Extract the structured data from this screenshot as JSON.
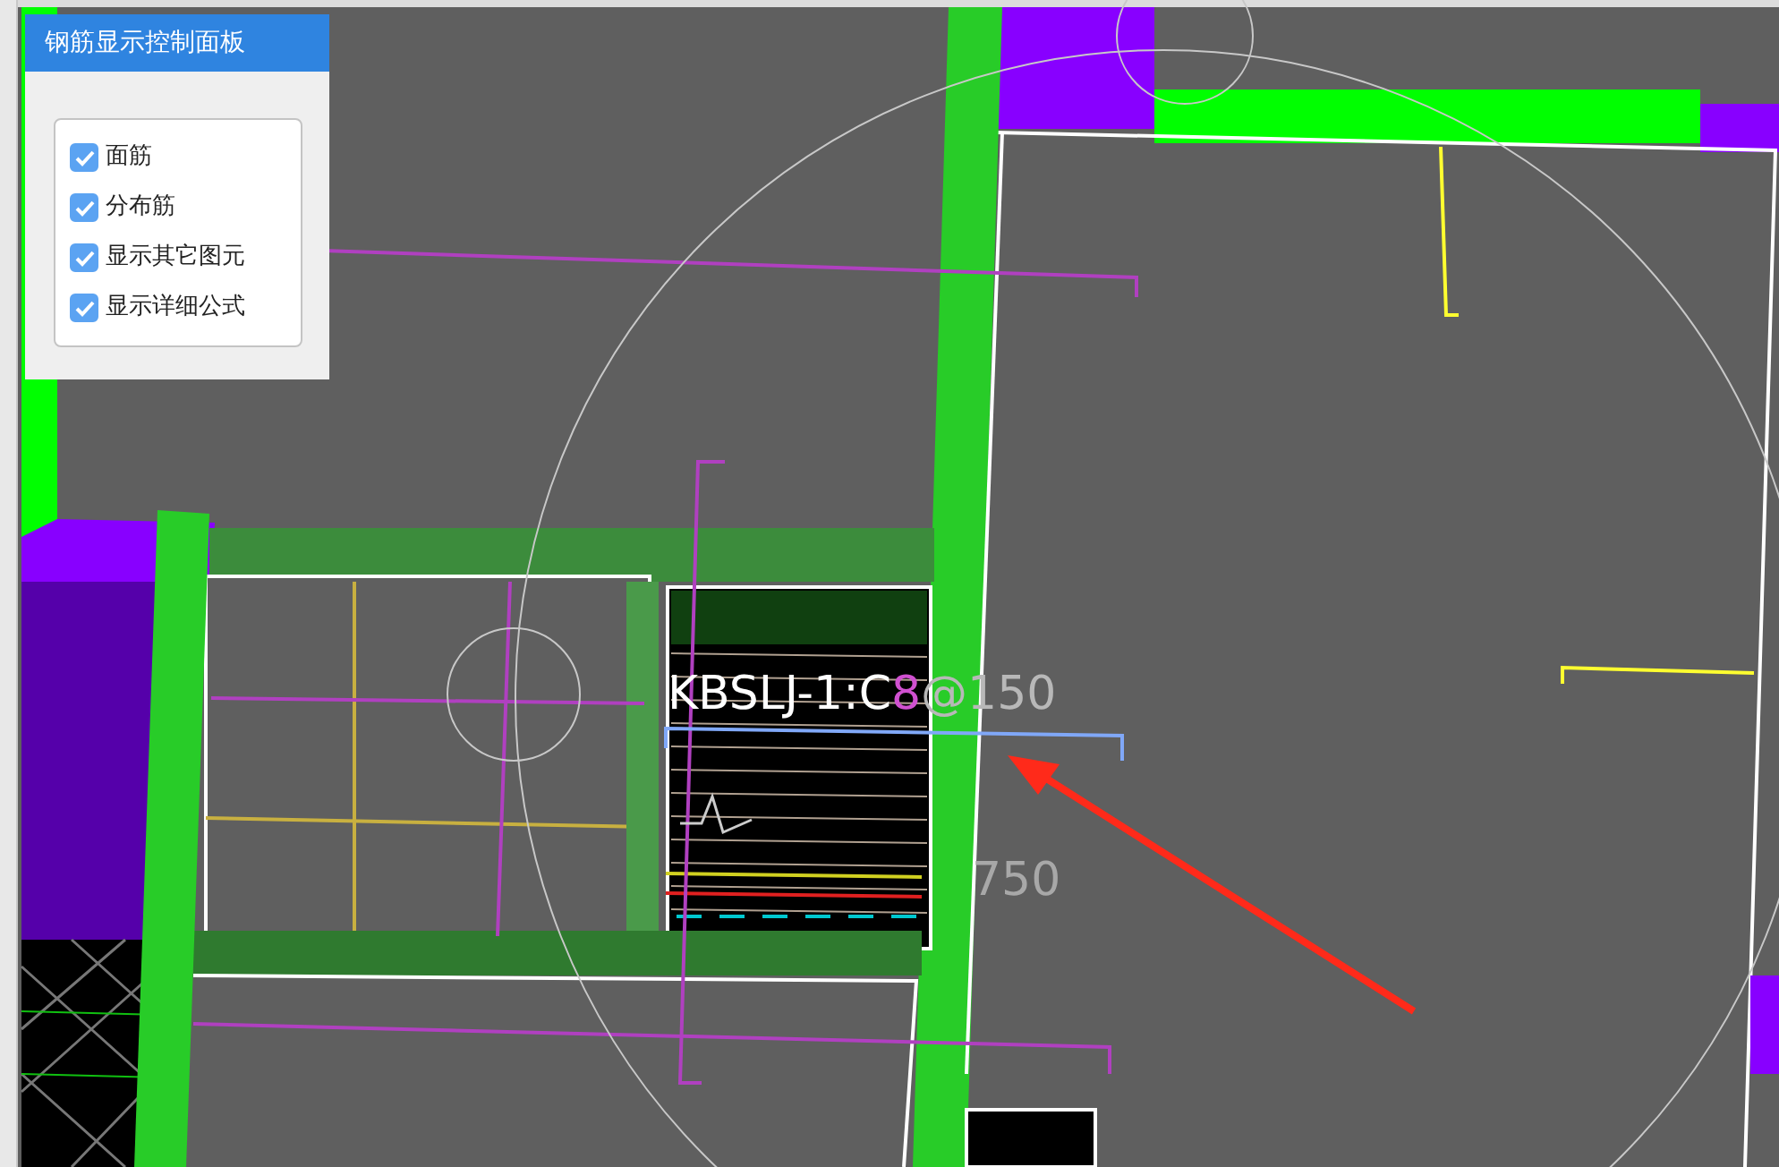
{
  "panel": {
    "title": "钢筋显示控制面板",
    "options": [
      {
        "label": "面筋",
        "checked": true
      },
      {
        "label": "分布筋",
        "checked": true
      },
      {
        "label": "显示其它图元",
        "checked": true
      },
      {
        "label": "显示详细公式",
        "checked": true
      }
    ]
  },
  "drawing": {
    "rebar_label": {
      "parts": [
        {
          "text": "KBSLJ-1:C",
          "color": "#ffffff"
        },
        {
          "text": "8",
          "color": "#d050d0"
        },
        {
          "text": "@150",
          "color": "#b8b8b8"
        }
      ]
    },
    "dimension": "750"
  }
}
